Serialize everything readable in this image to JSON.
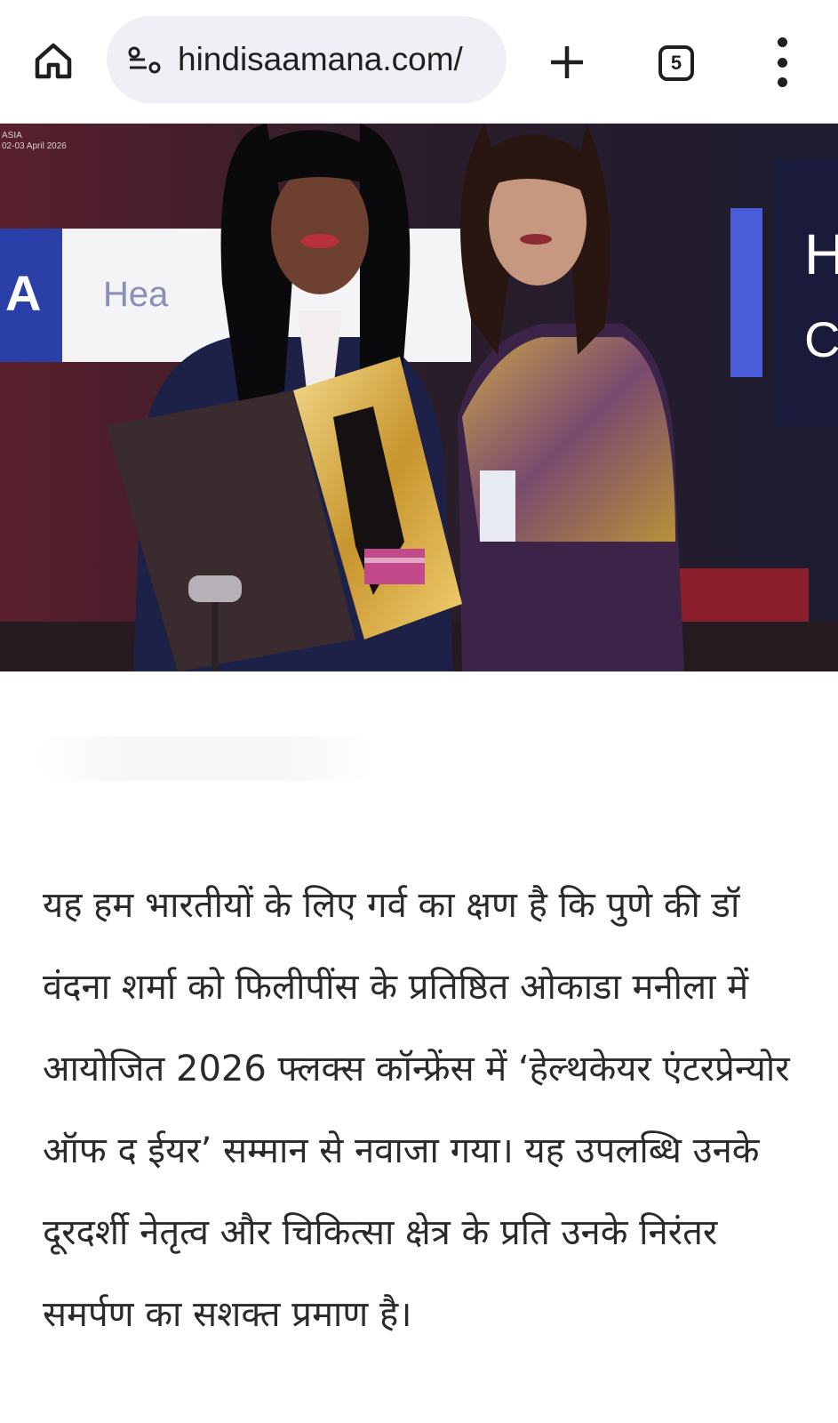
{
  "browser": {
    "url": "hindisaamana.com/",
    "tab_count": "5",
    "icons": {
      "home": "home-icon",
      "site_settings": "tune-icon",
      "new_tab": "plus-icon",
      "tabs": "tab-switcher-icon",
      "menu": "more-vert-icon"
    }
  },
  "photo": {
    "event_tag": "ASIA",
    "event_date": "02-03 April 2026",
    "banner_left": "A",
    "banner_word": "Hea",
    "banner_right_top": "H",
    "banner_right_bottom": "C"
  },
  "article": {
    "body": "यह हम भारतीयों के लिए गर्व का क्षण है कि पुणे की डॉ वंदना शर्मा को फिलीपींस के प्रतिष्ठित ओकाडा मनीला में आयोजित 2026 फ्लक्स कॉन्फ्रेंस में ‘हेल्थकेयर एंटरप्रेन्योर ऑफ द ईयर’ सम्मान से नवाजा गया। यह उपलब्धि उनके दूरदर्शी नेतृत्व और चिकित्सा क्षेत्र के प्रति उनके निरंतर समर्पण का सशक्त प्रमाण है।"
  },
  "colors": {
    "toolbar_bg": "#ffffff",
    "urlbar_bg": "#eef0f5",
    "text": "#2a2a2a",
    "banner_accent": "#2a3fa8"
  }
}
